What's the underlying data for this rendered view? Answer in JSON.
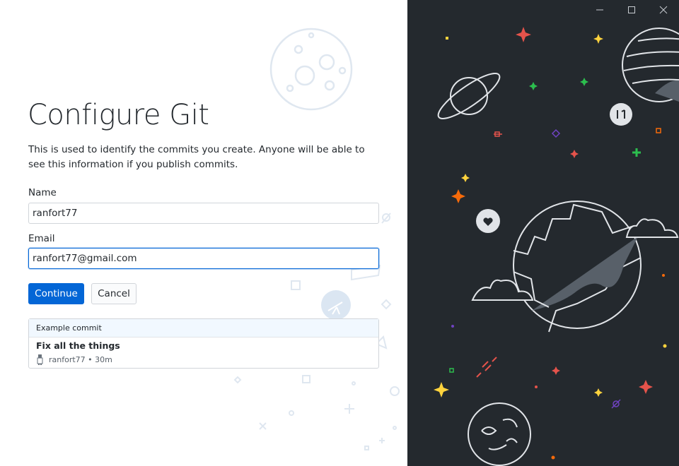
{
  "window": {
    "minimize_icon": "minimize-icon",
    "maximize_icon": "maximize-icon",
    "close_icon": "close-icon"
  },
  "form": {
    "title": "Configure Git",
    "description": "This is used to identify the commits you create. Anyone will be able to see this information if you publish commits.",
    "name_label": "Name",
    "name_value": "ranfort77",
    "email_label": "Email",
    "email_value": "ranfort77@gmail.com",
    "continue_label": "Continue",
    "cancel_label": "Cancel"
  },
  "example": {
    "header": "Example commit",
    "summary": "Fix all the things",
    "author": "ranfort77",
    "time": "30m"
  },
  "colors": {
    "primary": "#0366d6",
    "dark_panel": "#24292e",
    "accent_red": "#e5534b",
    "accent_green": "#2cbe4e",
    "accent_yellow": "#ffd33d",
    "accent_orange": "#f66a0a",
    "accent_purple": "#6f42c1"
  }
}
